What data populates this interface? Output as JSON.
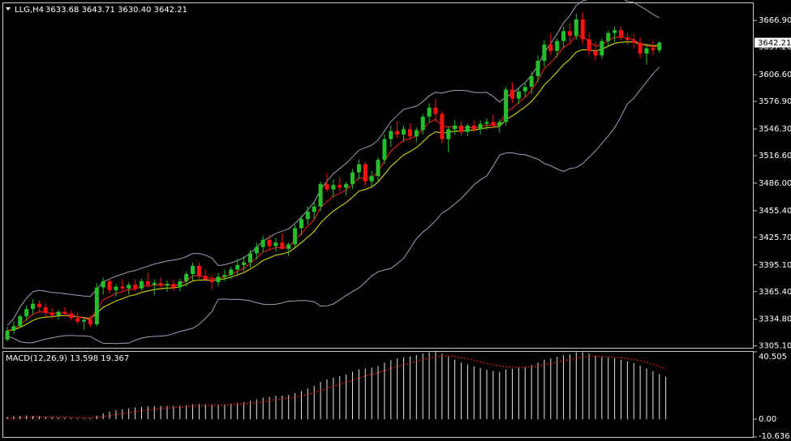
{
  "colors": {
    "background": "#000000",
    "frame": "#c8c8c8",
    "bull": "#22c02a",
    "bear": "#ff1010",
    "bollinger": "#9aa3b5",
    "ma_fast": "#ff2020",
    "ma_slow": "#e8e800",
    "macd_hist": "#e6e6e6",
    "macd_signal": "#ff2020",
    "price_tag_bg": "#ffffff",
    "price_tag_fg": "#000000"
  },
  "header": {
    "symbol_text": "LLG,H4",
    "ohlc_text": "3633.68 3643.71 3630.40 3642.21",
    "triangle_icon": "triangle-down-icon"
  },
  "price_tag": {
    "value": "3642.21",
    "behind_text": "3637.20"
  },
  "macd_panel": {
    "title": "MACD(12,26,9) 13.598 19.367",
    "axis_labels": [
      "40.505",
      "0.00",
      "-10.636"
    ],
    "range": [
      -10.636,
      40.505
    ]
  },
  "chart_data": {
    "type": "candlestick",
    "symbol": "LLG",
    "timeframe": "H4",
    "last_bar": {
      "open": 3633.68,
      "high": 3643.71,
      "low": 3630.4,
      "close": 3642.21
    },
    "price_axis": {
      "tick_labels": [
        "3666.90",
        "3637.20",
        "3606.60",
        "3576.90",
        "3546.30",
        "3516.60",
        "3486.00",
        "3455.40",
        "3425.70",
        "3395.10",
        "3365.40",
        "3334.80",
        "3305.10"
      ],
      "ylim": [
        3303.0,
        3686.0
      ]
    },
    "candles": [
      [
        3312,
        3326,
        3310,
        3322
      ],
      [
        3322,
        3333,
        3318,
        3327
      ],
      [
        3327,
        3340,
        3325,
        3338
      ],
      [
        3338,
        3350,
        3333,
        3346
      ],
      [
        3346,
        3357,
        3340,
        3352
      ],
      [
        3352,
        3356,
        3343,
        3348
      ],
      [
        3348,
        3352,
        3338,
        3342
      ],
      [
        3342,
        3347,
        3335,
        3339
      ],
      [
        3339,
        3345,
        3334,
        3343
      ],
      [
        3343,
        3348,
        3338,
        3341
      ],
      [
        3341,
        3345,
        3333,
        3336
      ],
      [
        3336,
        3342,
        3329,
        3332
      ],
      [
        3332,
        3337,
        3323,
        3334
      ],
      [
        3334,
        3339,
        3326,
        3329
      ],
      [
        3329,
        3375,
        3327,
        3370
      ],
      [
        3370,
        3381,
        3362,
        3377
      ],
      [
        3377,
        3380,
        3363,
        3367
      ],
      [
        3367,
        3374,
        3360,
        3371
      ],
      [
        3371,
        3379,
        3365,
        3369
      ],
      [
        3369,
        3376,
        3362,
        3373
      ],
      [
        3373,
        3378,
        3366,
        3369
      ],
      [
        3369,
        3380,
        3367,
        3377
      ],
      [
        3377,
        3386,
        3370,
        3373
      ],
      [
        3373,
        3379,
        3361,
        3375
      ],
      [
        3375,
        3381,
        3369,
        3372
      ],
      [
        3372,
        3378,
        3365,
        3374
      ],
      [
        3374,
        3379,
        3366,
        3370
      ],
      [
        3370,
        3380,
        3366,
        3377
      ],
      [
        3377,
        3388,
        3371,
        3385
      ],
      [
        3385,
        3398,
        3378,
        3394
      ],
      [
        3394,
        3398,
        3380,
        3383
      ],
      [
        3383,
        3390,
        3377,
        3379
      ],
      [
        3379,
        3384,
        3368,
        3376
      ],
      [
        3376,
        3386,
        3371,
        3382
      ],
      [
        3382,
        3390,
        3377,
        3384
      ],
      [
        3384,
        3393,
        3379,
        3390
      ],
      [
        3390,
        3402,
        3385,
        3395
      ],
      [
        3395,
        3405,
        3388,
        3398
      ],
      [
        3398,
        3412,
        3392,
        3408
      ],
      [
        3408,
        3420,
        3401,
        3415
      ],
      [
        3415,
        3427,
        3409,
        3423
      ],
      [
        3423,
        3428,
        3412,
        3416
      ],
      [
        3416,
        3425,
        3410,
        3420
      ],
      [
        3420,
        3430,
        3412,
        3413
      ],
      [
        3413,
        3420,
        3405,
        3418
      ],
      [
        3418,
        3440,
        3414,
        3436
      ],
      [
        3436,
        3450,
        3428,
        3446
      ],
      [
        3446,
        3460,
        3440,
        3454
      ],
      [
        3454,
        3465,
        3446,
        3460
      ],
      [
        3460,
        3488,
        3455,
        3485
      ],
      [
        3485,
        3497,
        3476,
        3479
      ],
      [
        3479,
        3490,
        3470,
        3484
      ],
      [
        3484,
        3493,
        3477,
        3481
      ],
      [
        3481,
        3488,
        3472,
        3485
      ],
      [
        3485,
        3502,
        3480,
        3498
      ],
      [
        3498,
        3512,
        3490,
        3507
      ],
      [
        3507,
        3510,
        3483,
        3488
      ],
      [
        3488,
        3500,
        3480,
        3494
      ],
      [
        3494,
        3515,
        3488,
        3512
      ],
      [
        3512,
        3540,
        3507,
        3535
      ],
      [
        3535,
        3550,
        3526,
        3544
      ],
      [
        3544,
        3555,
        3536,
        3540
      ],
      [
        3540,
        3550,
        3532,
        3546
      ],
      [
        3546,
        3553,
        3535,
        3538
      ],
      [
        3538,
        3548,
        3532,
        3545
      ],
      [
        3545,
        3563,
        3540,
        3560
      ],
      [
        3560,
        3575,
        3553,
        3570
      ],
      [
        3570,
        3580,
        3555,
        3563
      ],
      [
        3563,
        3566,
        3530,
        3535
      ],
      [
        3535,
        3549,
        3520,
        3546
      ],
      [
        3546,
        3556,
        3540,
        3550
      ],
      [
        3550,
        3555,
        3539,
        3543
      ],
      [
        3543,
        3552,
        3538,
        3550
      ],
      [
        3550,
        3556,
        3543,
        3546
      ],
      [
        3546,
        3556,
        3540,
        3552
      ],
      [
        3552,
        3558,
        3545,
        3554
      ],
      [
        3554,
        3562,
        3547,
        3550
      ],
      [
        3550,
        3557,
        3542,
        3554
      ],
      [
        3554,
        3593,
        3550,
        3590
      ],
      [
        3590,
        3598,
        3575,
        3580
      ],
      [
        3580,
        3592,
        3574,
        3588
      ],
      [
        3588,
        3598,
        3582,
        3593
      ],
      [
        3593,
        3610,
        3585,
        3605
      ],
      [
        3605,
        3628,
        3598,
        3622
      ],
      [
        3622,
        3645,
        3615,
        3640
      ],
      [
        3640,
        3652,
        3628,
        3633
      ],
      [
        3633,
        3647,
        3626,
        3644
      ],
      [
        3644,
        3660,
        3636,
        3655
      ],
      [
        3655,
        3664,
        3643,
        3650
      ],
      [
        3650,
        3674,
        3645,
        3668
      ],
      [
        3668,
        3676,
        3641,
        3646
      ],
      [
        3646,
        3654,
        3628,
        3633
      ],
      [
        3633,
        3643,
        3622,
        3628
      ],
      [
        3628,
        3647,
        3624,
        3644
      ],
      [
        3644,
        3656,
        3638,
        3653
      ],
      [
        3653,
        3660,
        3643,
        3656
      ],
      [
        3656,
        3660,
        3645,
        3648
      ],
      [
        3648,
        3654,
        3640,
        3645
      ],
      [
        3645,
        3652,
        3636,
        3642
      ],
      [
        3642,
        3648,
        3625,
        3630
      ],
      [
        3630,
        3641,
        3618,
        3636
      ],
      [
        3636,
        3644,
        3628,
        3634
      ],
      [
        3633.68,
        3643.71,
        3630.4,
        3642.21
      ]
    ],
    "indicators": [
      "Bollinger Bands",
      "Moving Average (fast)",
      "Moving Average (slow)",
      "MACD(12,26,9)"
    ],
    "macd": {
      "histogram": [
        1.5,
        1.8,
        2.0,
        2.2,
        2.0,
        1.8,
        1.5,
        1.2,
        1.0,
        0.9,
        0.8,
        0.6,
        0.4,
        0.5,
        2.2,
        3.6,
        4.6,
        5.4,
        6.0,
        6.6,
        7.0,
        7.5,
        7.8,
        7.9,
        8.0,
        8.0,
        8.1,
        8.2,
        8.5,
        9.0,
        9.2,
        9.0,
        8.9,
        8.9,
        9.0,
        9.3,
        9.8,
        10.3,
        11.1,
        12.0,
        13.0,
        13.5,
        14.0,
        14.2,
        14.6,
        15.7,
        17.0,
        18.5,
        20.0,
        22.5,
        24.0,
        25.0,
        26.0,
        27.0,
        28.5,
        30.0,
        30.5,
        31.0,
        32.0,
        34.0,
        35.5,
        36.5,
        37.2,
        37.8,
        38.5,
        39.5,
        40.3,
        40.5,
        39.3,
        37.5,
        35.8,
        34.0,
        33.0,
        31.8,
        30.8,
        29.8,
        29.0,
        28.5,
        30.0,
        30.3,
        30.8,
        31.5,
        32.5,
        34.0,
        35.8,
        36.5,
        37.5,
        38.5,
        39.0,
        40.2,
        40.3,
        39.5,
        38.3,
        37.4,
        37.0,
        36.6,
        35.8,
        34.8,
        33.8,
        32.2,
        30.5,
        28.8,
        27.2,
        25.5
      ],
      "signal": [
        0.3,
        0.6,
        0.9,
        1.1,
        1.3,
        1.4,
        1.4,
        1.4,
        1.3,
        1.2,
        1.1,
        1.0,
        0.9,
        0.8,
        1.1,
        1.6,
        2.2,
        2.8,
        3.4,
        4.0,
        4.6,
        5.1,
        5.6,
        6.0,
        6.4,
        6.7,
        7.0,
        7.2,
        7.5,
        7.8,
        8.1,
        8.3,
        8.4,
        8.5,
        8.6,
        8.8,
        9.0,
        9.2,
        9.6,
        10.0,
        10.6,
        11.1,
        11.7,
        12.2,
        12.7,
        13.3,
        14.0,
        14.9,
        15.9,
        17.2,
        18.5,
        19.8,
        21.0,
        22.2,
        23.5,
        24.8,
        26.0,
        27.0,
        28.0,
        29.2,
        30.5,
        31.7,
        32.8,
        33.8,
        34.8,
        35.8,
        36.7,
        37.5,
        38.0,
        38.0,
        37.7,
        37.0,
        36.2,
        35.4,
        34.5,
        33.6,
        32.8,
        32.0,
        31.6,
        31.3,
        31.2,
        31.2,
        31.4,
        31.9,
        32.6,
        33.4,
        34.2,
        35.0,
        35.8,
        36.6,
        37.3,
        37.7,
        37.8,
        37.7,
        37.5,
        37.3,
        37.0,
        36.5,
        35.9,
        35.2,
        34.2,
        33.0,
        31.7,
        30.2
      ]
    }
  }
}
